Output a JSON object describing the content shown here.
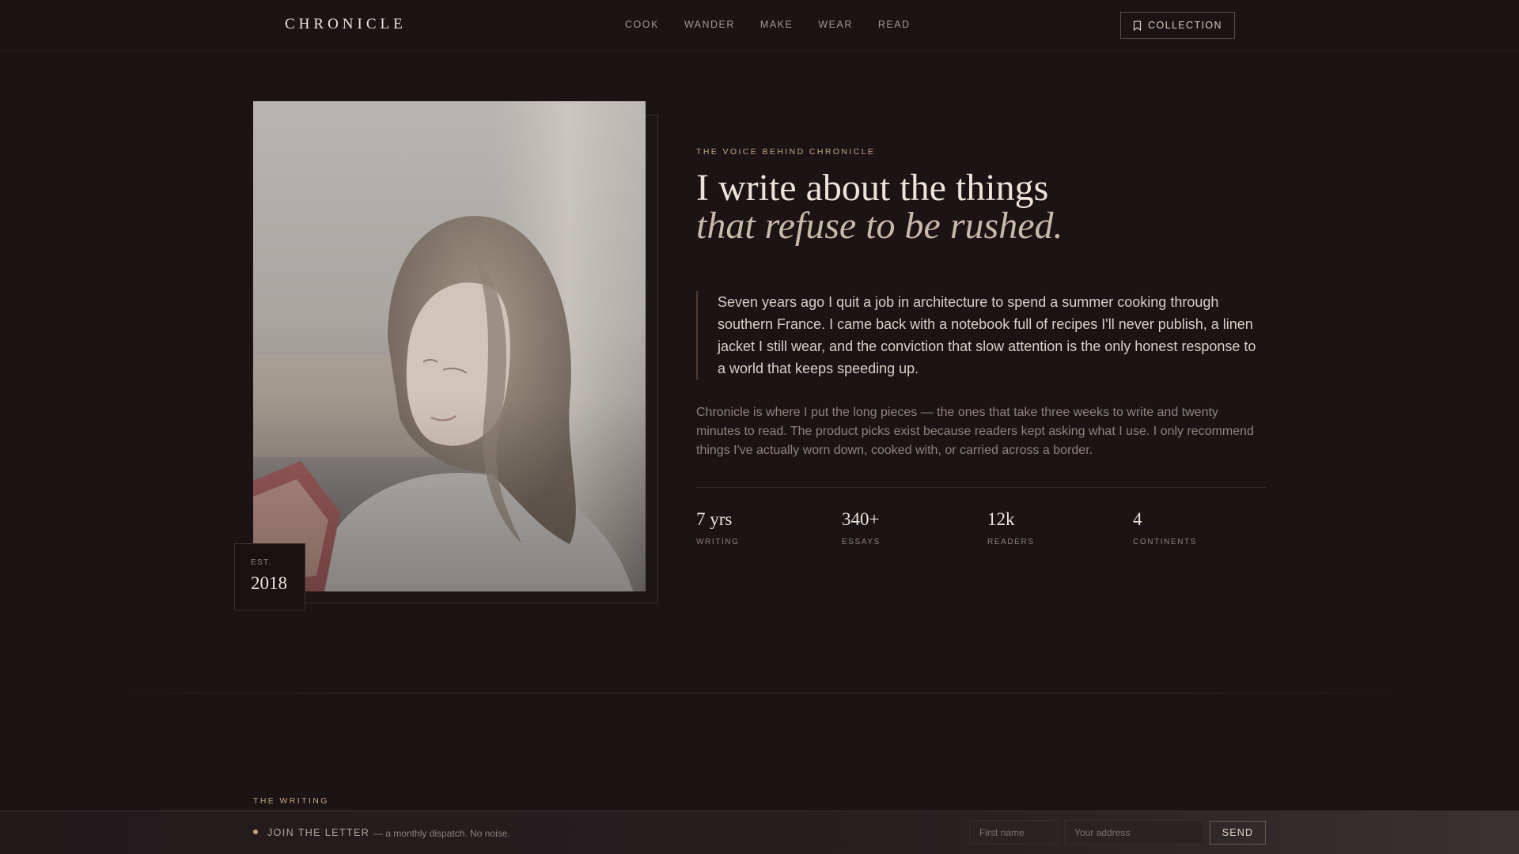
{
  "brand": {
    "logo": "CHRONICLE"
  },
  "nav": {
    "items": [
      {
        "label": "COOK"
      },
      {
        "label": "WANDER"
      },
      {
        "label": "MAKE"
      },
      {
        "label": "WEAR"
      },
      {
        "label": "READ"
      }
    ]
  },
  "header": {
    "collection_label": "COLLECTION",
    "collection_icon": "bookmark-icon"
  },
  "photo": {
    "badge_label": "EST.",
    "badge_year": "2018"
  },
  "about": {
    "eyebrow": "THE VOICE BEHIND CHRONICLE",
    "headline_line1": "I write about the things",
    "headline_line2": "that refuse to be rushed.",
    "quote": "Seven years ago I quit a job in architecture to spend a summer cooking through southern France. I came back with a notebook full of recipes I'll never publish, a linen jacket I still wear, and the conviction that slow attention is the only honest response to a world that keeps speeding up.",
    "body": "Chronicle is where I put the long pieces — the ones that take three weeks to write and twenty minutes to read. The product picks exist because readers kept asking what I use. I only recommend things I've actually worn down, cooked with, or carried across a border."
  },
  "stats": [
    {
      "value": "7 yrs",
      "label": "WRITING"
    },
    {
      "value": "340+",
      "label": "ESSAYS"
    },
    {
      "value": "12k",
      "label": "READERS"
    },
    {
      "value": "4",
      "label": "CONTINENTS"
    }
  ],
  "writing_section": {
    "label": "THE WRITING"
  },
  "newsletter": {
    "title": "JOIN THE LETTER",
    "subtitle": "— a monthly dispatch. No noise.",
    "first_name_placeholder": "First name",
    "address_placeholder": "Your address",
    "send_label": "SEND"
  },
  "colors": {
    "accent": "#c6a67a",
    "background": "#1c1315",
    "text": "#ece3d9"
  }
}
